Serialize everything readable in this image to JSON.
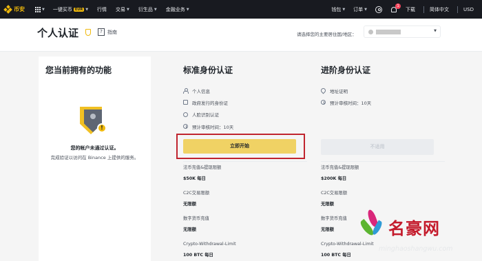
{
  "nav": {
    "logo": "币安",
    "items": [
      {
        "label": "一键买币",
        "badge": "EUR"
      },
      {
        "label": "行情"
      },
      {
        "label": "交易"
      },
      {
        "label": "衍生品"
      },
      {
        "label": "金融业务"
      }
    ],
    "right": {
      "wallet": "钱包",
      "orders": "订单",
      "notification_count": "1",
      "download": "下载",
      "language": "简体中文",
      "currency": "USD"
    }
  },
  "header": {
    "title": "个人认证",
    "guide": "指南",
    "region_label": "请选择您的主要居住国/地区："
  },
  "current": {
    "title": "您当前拥有的功能",
    "message": "您的帐户未通过认证。",
    "sub": "完成验证以访问在 Binance 上提供的服务。"
  },
  "standard": {
    "title": "标准身份认证",
    "requirements": [
      {
        "icon": "person-icon",
        "label": "个人信息"
      },
      {
        "icon": "id-card-icon",
        "label": "政府发行的身份证"
      },
      {
        "icon": "face-icon",
        "label": "人脸识别认证"
      },
      {
        "icon": "clock-icon",
        "label": "预计审核时间：10天"
      }
    ],
    "button": "立即开始",
    "limits": [
      {
        "label": "法币充值&提现限额",
        "value": "$50K 每日"
      },
      {
        "label": "C2C交易限额",
        "value": "无限额"
      },
      {
        "label": "数字货币充值",
        "value": "无限额"
      },
      {
        "label": "Crypto-Withdrawal-Limit",
        "value": "100 BTC 每日"
      }
    ]
  },
  "advanced": {
    "title": "进阶身份认证",
    "requirements": [
      {
        "icon": "location-icon",
        "label": "地址证明"
      },
      {
        "icon": "clock-icon",
        "label": "预计审核时间：10天"
      }
    ],
    "button": "不适用",
    "limits": [
      {
        "label": "法币充值&提现限额",
        "value": "$200K 每日"
      },
      {
        "label": "C2C交易限额",
        "value": "无限额"
      },
      {
        "label": "数字货币充值",
        "value": "无限额"
      },
      {
        "label": "Crypto-Withdrawal-Limit",
        "value": "100 BTC 每日"
      }
    ]
  },
  "watermark": {
    "title": "名豪网",
    "url": "minghaoshangwu.com"
  },
  "colors": {
    "brand": "#f0b90b",
    "nav_bg": "#181a20",
    "highlight": "#c0242e"
  }
}
